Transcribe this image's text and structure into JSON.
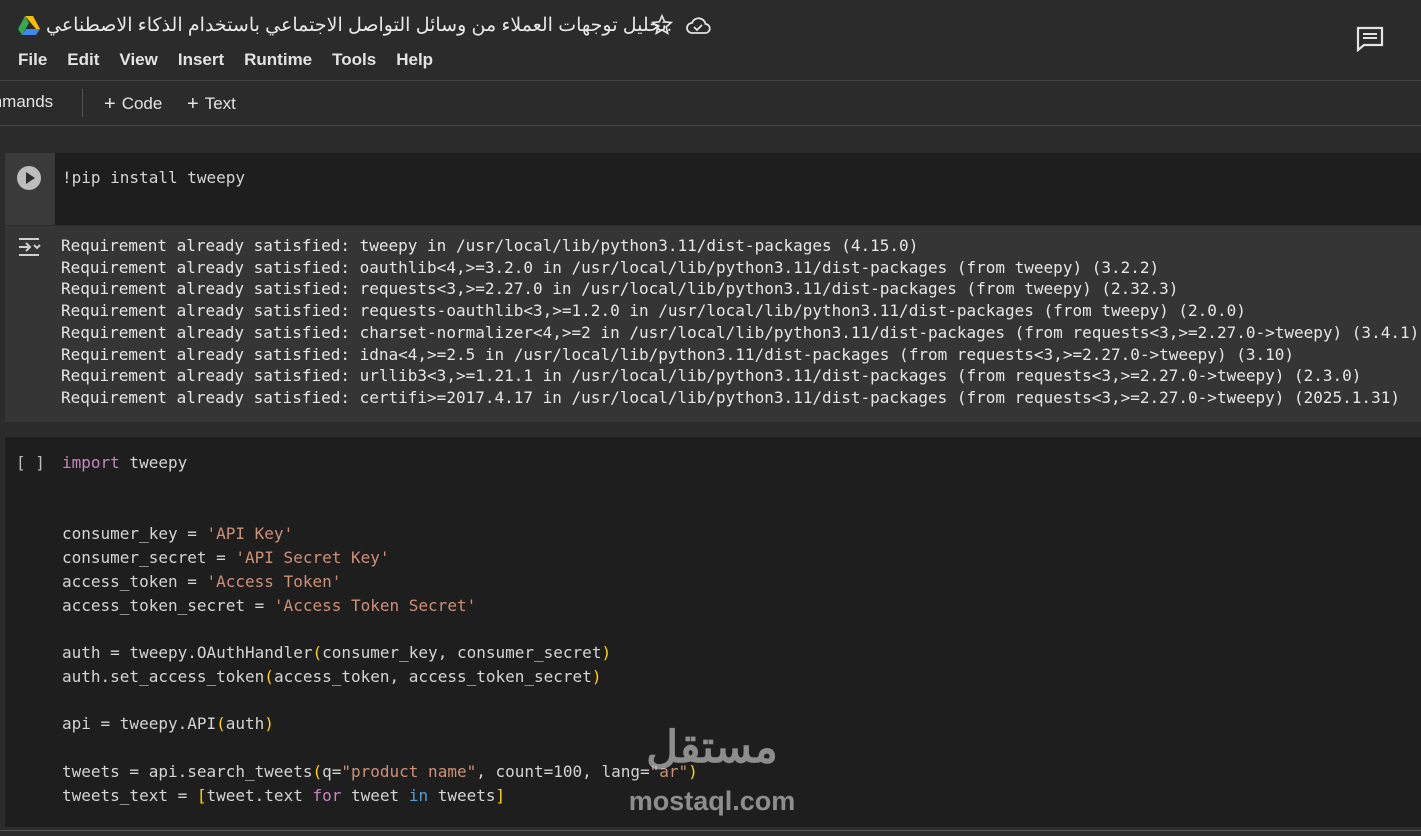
{
  "header": {
    "title": ".تحليل توجهات العملاء من وسائل التواصل الاجتماعي باستخدام الذكاء الاصطناعي",
    "icons": [
      "drive-logo-icon",
      "star-icon",
      "cloud-icon",
      "comment-icon"
    ]
  },
  "menu": {
    "items": [
      "File",
      "Edit",
      "View",
      "Insert",
      "Runtime",
      "Tools",
      "Help"
    ]
  },
  "toolbar": {
    "commands_label": "mmands",
    "code_label": "Code",
    "text_label": "Text"
  },
  "cell1": {
    "code": "!pip install tweepy"
  },
  "output": {
    "lines": [
      "Requirement already satisfied: tweepy in /usr/local/lib/python3.11/dist-packages (4.15.0)",
      "Requirement already satisfied: oauthlib<4,>=3.2.0 in /usr/local/lib/python3.11/dist-packages (from tweepy) (3.2.2)",
      "Requirement already satisfied: requests<3,>=2.27.0 in /usr/local/lib/python3.11/dist-packages (from tweepy) (2.32.3)",
      "Requirement already satisfied: requests-oauthlib<3,>=1.2.0 in /usr/local/lib/python3.11/dist-packages (from tweepy) (2.0.0)",
      "Requirement already satisfied: charset-normalizer<4,>=2 in /usr/local/lib/python3.11/dist-packages (from requests<3,>=2.27.0->tweepy) (3.4.1)",
      "Requirement already satisfied: idna<4,>=2.5 in /usr/local/lib/python3.11/dist-packages (from requests<3,>=2.27.0->tweepy) (3.10)",
      "Requirement already satisfied: urllib3<3,>=1.21.1 in /usr/local/lib/python3.11/dist-packages (from requests<3,>=2.27.0->tweepy) (2.3.0)",
      "Requirement already satisfied: certifi>=2017.4.17 in /usr/local/lib/python3.11/dist-packages (from requests<3,>=2.27.0->tweepy) (2025.1.31)"
    ]
  },
  "cell2": {
    "exec_count": "[ ]",
    "l1_kw": "import",
    "l1_rest": " tweepy",
    "l2_a": "consumer_key = ",
    "l2_s": "'API Key'",
    "l3_a": "consumer_secret = ",
    "l3_s": "'API Secret Key'",
    "l4_a": "access_token = ",
    "l4_s": "'Access Token'",
    "l5_a": "access_token_secret = ",
    "l5_s": "'Access Token Secret'",
    "l6_a": "auth = tweepy.OAuthHandler",
    "l6_p1": "(",
    "l6_b": "consumer_key, consumer_secret",
    "l6_p2": ")",
    "l7_a": "auth.set_access_token",
    "l7_p1": "(",
    "l7_b": "access_token, access_token_secret",
    "l7_p2": ")",
    "l8_a": "api = tweepy.API",
    "l8_p1": "(",
    "l8_b": "auth",
    "l8_p2": ")",
    "l9_a": "tweets = api.search_tweets",
    "l9_p1": "(",
    "l9_b": "q=",
    "l9_s1": "\"product name\"",
    "l9_c": ", count=100, lang=",
    "l9_s2": "\"ar\"",
    "l9_p2": ")",
    "l10_a": "tweets_text = ",
    "l10_p1": "[",
    "l10_b": "tweet.text ",
    "l10_k1": "for",
    "l10_c": " tweet ",
    "l10_k2": "in",
    "l10_d": " tweets",
    "l10_p2": "]"
  },
  "watermark": {
    "arabic": "مستقل",
    "latin": "mostaql.com"
  }
}
